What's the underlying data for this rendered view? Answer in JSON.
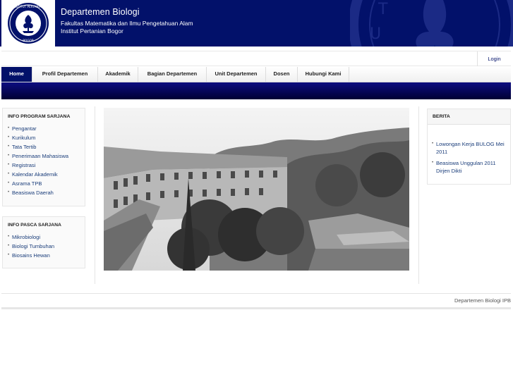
{
  "header": {
    "title": "Departemen Biologi",
    "subtitle_line1": "Fakultas Matematika dan Ilmu Pengetahuan Alam",
    "subtitle_line2": "Institut Pertanian Bogor",
    "logo_text_top": "INSTITUT PERTANIAN",
    "logo_text_bottom": "BOGOR",
    "background_color": "#02116a"
  },
  "topbar": {
    "login_label": "Login"
  },
  "nav": {
    "items": [
      {
        "label": "Home"
      },
      {
        "label": "Profil Departemen"
      },
      {
        "label": "Akademik"
      },
      {
        "label": "Bagian Departemen"
      },
      {
        "label": "Unit Departemen"
      },
      {
        "label": "Dosen"
      },
      {
        "label": "Hubungi Kami"
      }
    ],
    "active": "Home"
  },
  "sidebar": {
    "sarjana": {
      "title": "INFO PROGRAM SARJANA",
      "items": [
        {
          "label": "Pengantar"
        },
        {
          "label": "Kurikulum"
        },
        {
          "label": "Tata Tertib"
        },
        {
          "label": "Penerimaan Mahasiswa"
        },
        {
          "label": "Registrasi"
        },
        {
          "label": "Kalendar Akademik"
        },
        {
          "label": "Asrama TPB"
        },
        {
          "label": "Beasiswa Daerah"
        }
      ]
    },
    "pasca": {
      "title": "INFO PASCA SARJANA",
      "items": [
        {
          "label": "Mikrobiologi"
        },
        {
          "label": "Biologi Tumbuhan"
        },
        {
          "label": "Biosains Hewan"
        }
      ]
    }
  },
  "main": {
    "photo_icon": "campus-photo"
  },
  "news": {
    "title": "BERITA",
    "items": [
      {
        "label": "Lowongan Kerja BULOG Mei 2011"
      },
      {
        "label": "Beasiswa Unggulan 2011 Dirjen Dikti"
      }
    ]
  },
  "footer": {
    "text": "Departemen Biologi IPB"
  }
}
